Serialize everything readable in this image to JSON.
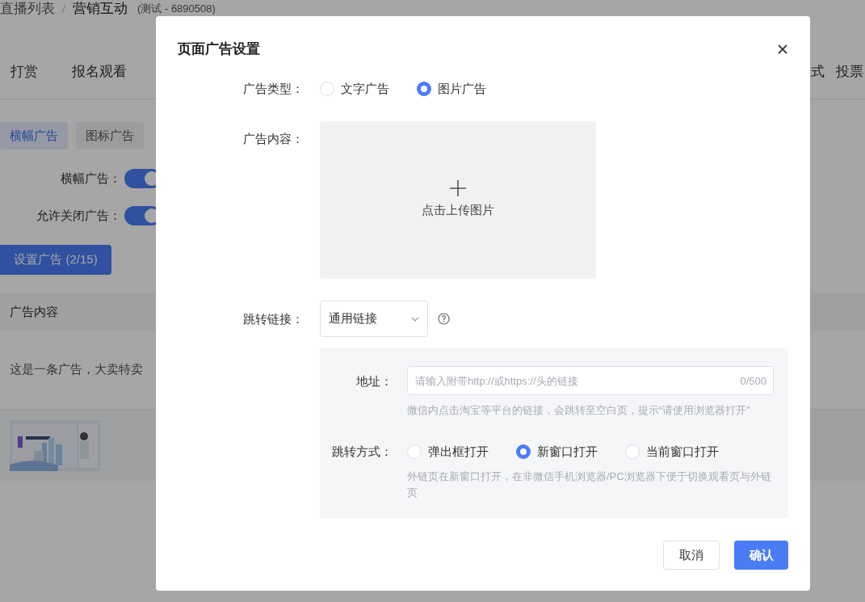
{
  "page": {
    "breadcrumb": [
      "直播列表",
      "营销互动"
    ],
    "breadcrumb_note": "(测试 - 6890508)",
    "tabs_left": [
      "打赏",
      "报名观看"
    ],
    "tabs_right": [
      "式",
      "投票"
    ],
    "ad_tabs": [
      {
        "label": "横幅广告",
        "selected": true
      },
      {
        "label": "图标广告",
        "selected": false
      }
    ],
    "toggles": [
      {
        "label": "横幅广告：",
        "on": true
      },
      {
        "label": "允许关闭广告：",
        "on": true
      }
    ],
    "set_button": "设置广告 (2/15)",
    "table": {
      "columns": [
        "广告内容"
      ],
      "rows": [
        {
          "kind": "text",
          "text": "这是一条广告，大卖特卖"
        },
        {
          "kind": "picture"
        }
      ]
    }
  },
  "dialog": {
    "title": "页面广告设置",
    "ad_type": {
      "label": "广告类型：",
      "options": [
        {
          "label": "文字广告",
          "selected": false
        },
        {
          "label": "图片广告",
          "selected": true
        }
      ]
    },
    "content": {
      "label": "广告内容：",
      "upload_text": "点击上传图片"
    },
    "link": {
      "label": "跳转链接：",
      "value": "通用链接"
    },
    "address": {
      "label": "地址：",
      "placeholder": "请输入附带http://或https://头的链接",
      "counter": "0/500",
      "hint": "微信内点击淘宝等平台的链接，会跳转至空白页，提示“请使用浏览器打开”"
    },
    "open_mode": {
      "label": "跳转方式：",
      "options": [
        {
          "label": "弹出框打开",
          "selected": false
        },
        {
          "label": "新窗口打开",
          "selected": true
        },
        {
          "label": "当前窗口打开",
          "selected": false
        }
      ],
      "hint": "外链页在新窗口打开，在非微信手机浏览器/PC浏览器下便于切换观看页与外链页"
    },
    "buttons": {
      "cancel": "取消",
      "confirm": "确认"
    }
  }
}
